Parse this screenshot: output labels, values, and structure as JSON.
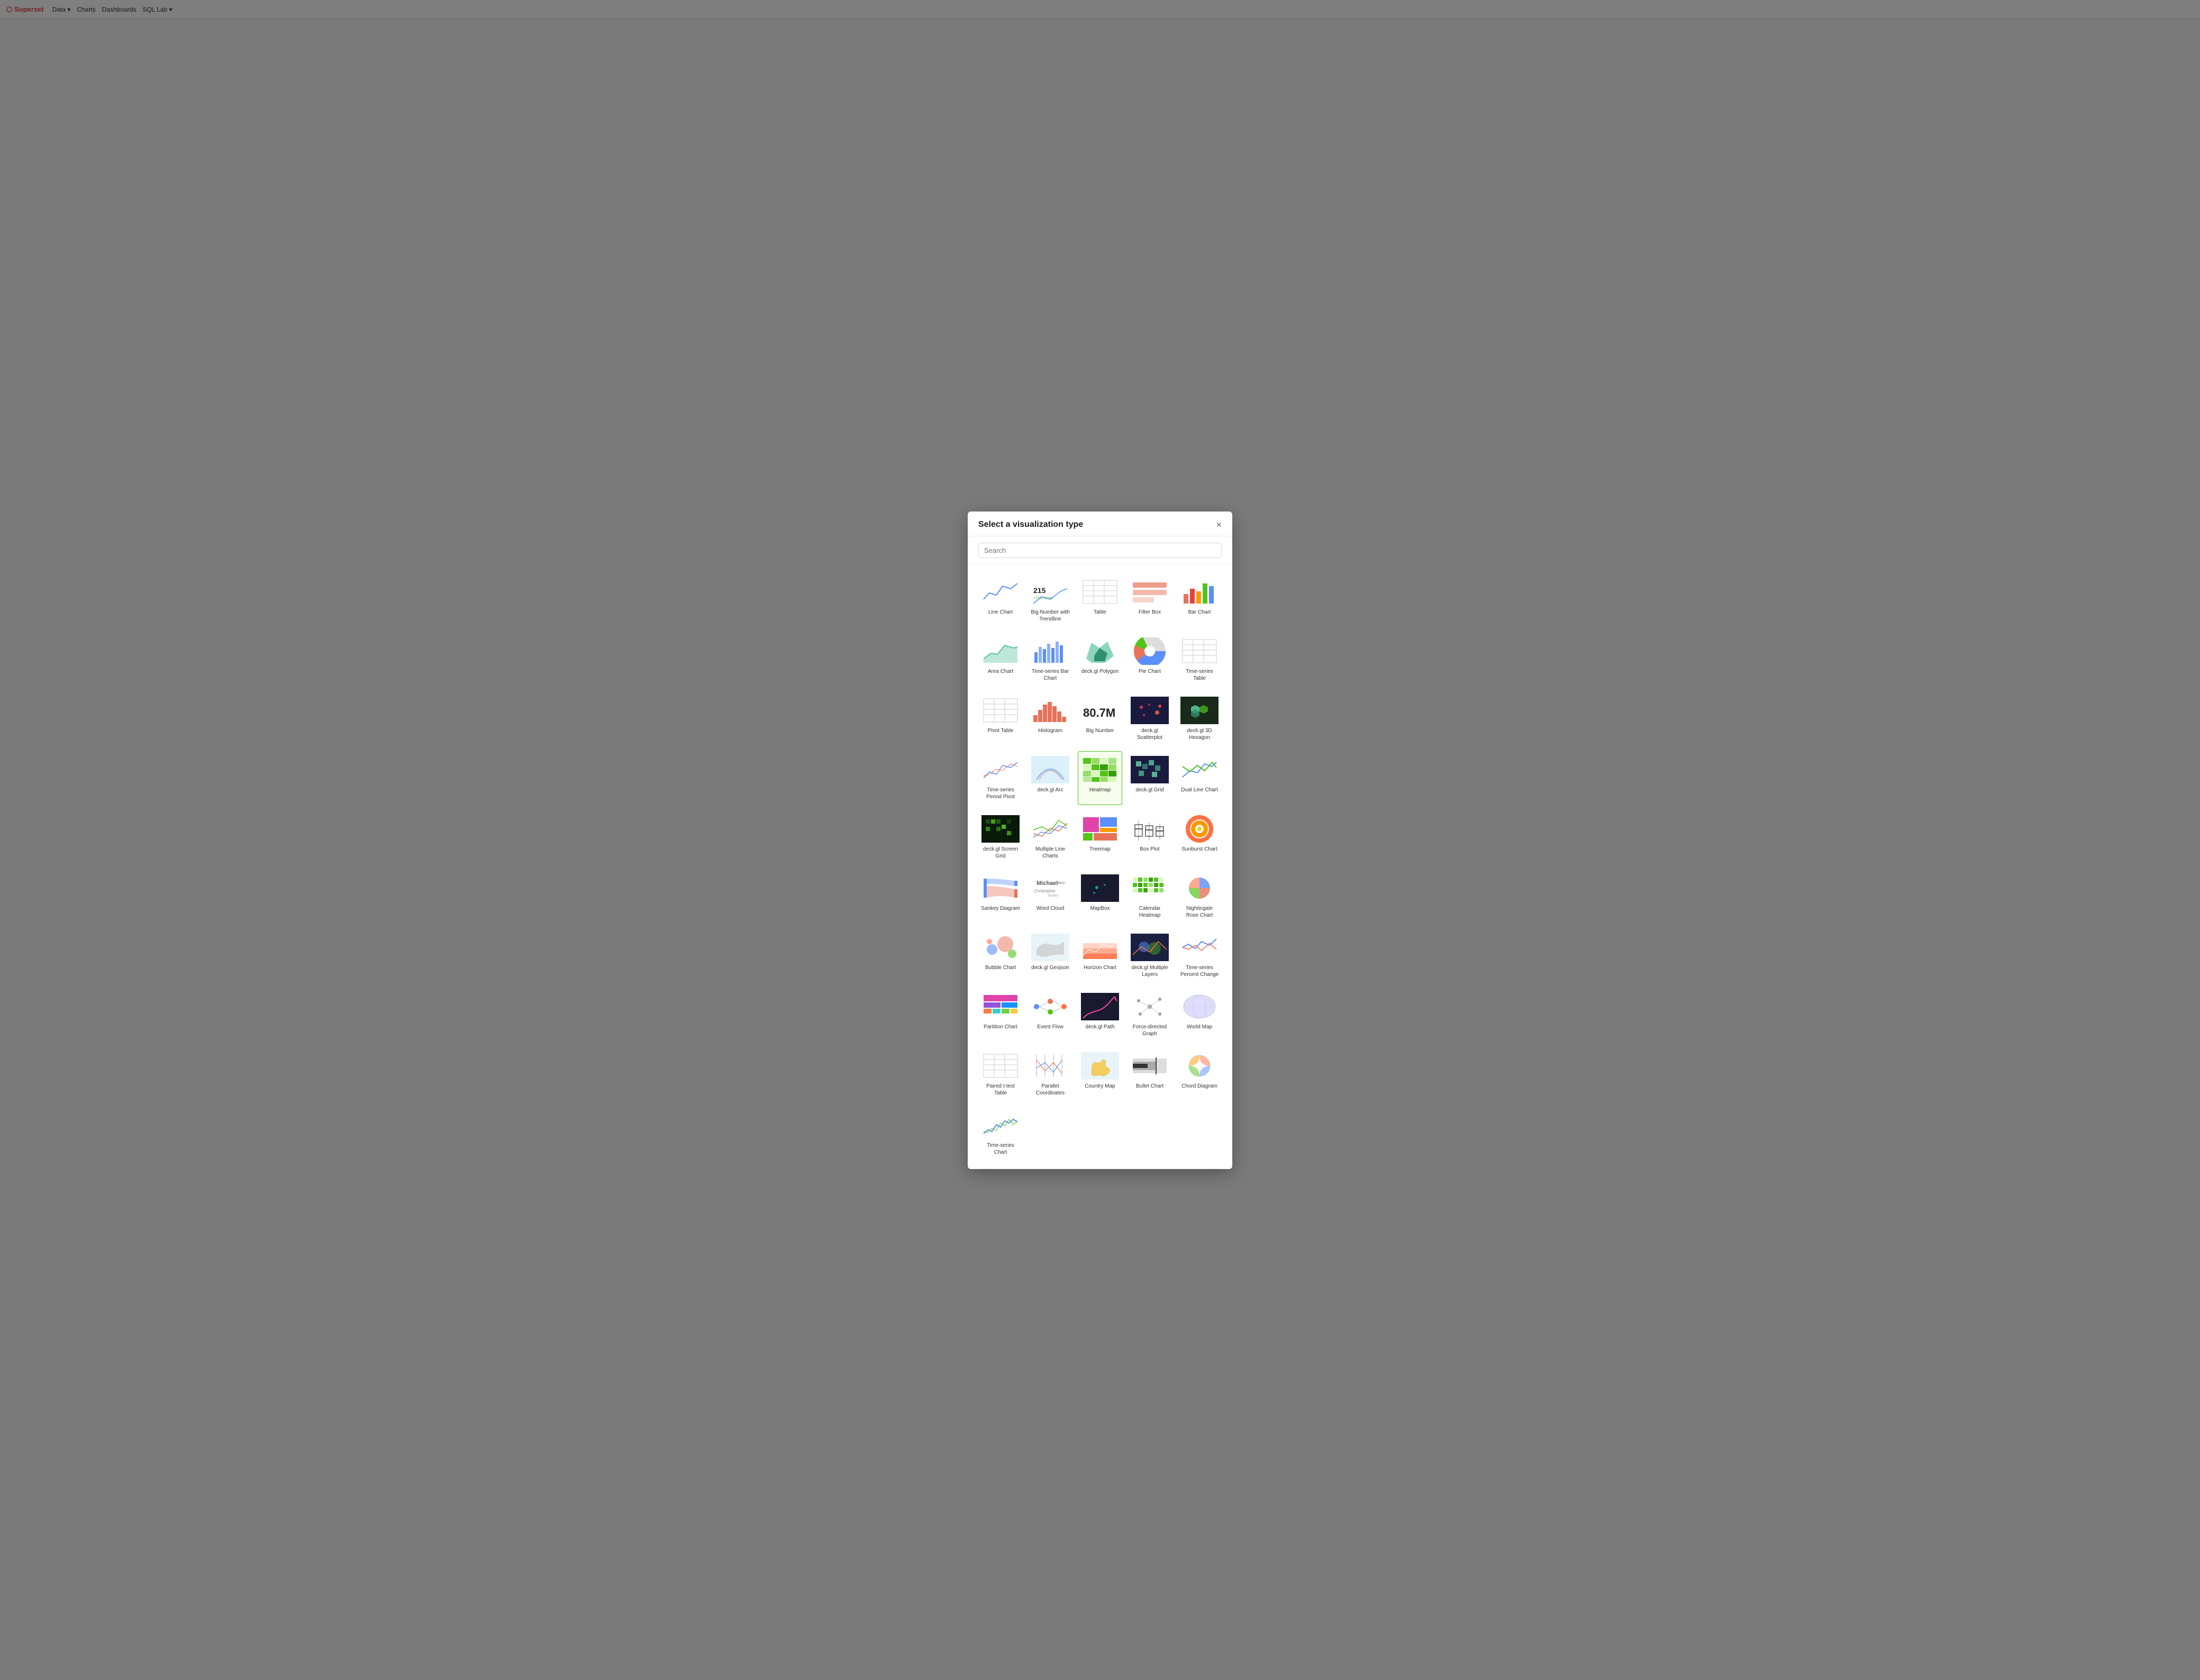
{
  "modal": {
    "title": "Select a visualization type",
    "search_placeholder": "Search",
    "close_label": "×"
  },
  "viz_types": [
    {
      "id": "line-chart",
      "label": "Line Chart",
      "color": "#5b8ff9",
      "type": "line"
    },
    {
      "id": "big-number-trendline",
      "label": "Big Number with Trendline",
      "color": "#5b8ff9",
      "type": "big-number-trend"
    },
    {
      "id": "table",
      "label": "Table",
      "color": "#aaa",
      "type": "table"
    },
    {
      "id": "filter-box",
      "label": "Filter Box",
      "color": "#e8735a",
      "type": "filter-box"
    },
    {
      "id": "bar-chart",
      "label": "Bar Chart",
      "color": "#e8735a",
      "type": "bar"
    },
    {
      "id": "area-chart",
      "label": "Area Chart",
      "color": "#5bc49f",
      "type": "area"
    },
    {
      "id": "time-series-bar",
      "label": "Time-series Bar Chart",
      "color": "#5b8ff9",
      "type": "ts-bar"
    },
    {
      "id": "deckgl-polygon",
      "label": "deck.gl Polygon",
      "color": "#5bc49f",
      "type": "map-green"
    },
    {
      "id": "pie-chart",
      "label": "Pie Chart",
      "color": "#5b8ff9",
      "type": "pie"
    },
    {
      "id": "time-series-table",
      "label": "Time-series Table",
      "color": "#aaa",
      "type": "table"
    },
    {
      "id": "pivot-table",
      "label": "Pivot Table",
      "color": "#aaa",
      "type": "table"
    },
    {
      "id": "histogram",
      "label": "Histogram",
      "color": "#e8735a",
      "type": "histogram"
    },
    {
      "id": "big-number",
      "label": "Big Number",
      "color": "#000",
      "type": "big-number"
    },
    {
      "id": "deckgl-scatter",
      "label": "deck.gl Scatterplot",
      "color": "#e8735a",
      "type": "scatter-map"
    },
    {
      "id": "deckgl-3d-hexagon",
      "label": "deck.gl 3D Hexagon",
      "color": "#5bc49f",
      "type": "hex3d"
    },
    {
      "id": "time-series-period-pivot",
      "label": "Time-series Period Pivot",
      "color": "#aaa",
      "type": "line2"
    },
    {
      "id": "deckgl-arc",
      "label": "deck.gl Arc",
      "color": "#87ceeb",
      "type": "arc"
    },
    {
      "id": "heatmap",
      "label": "Heatmap",
      "color": "#52c41a",
      "type": "heatmap",
      "selected": true
    },
    {
      "id": "deckgl-grid",
      "label": "deck.gl Grid",
      "color": "#5bc49f",
      "type": "grid-map"
    },
    {
      "id": "dual-line-chart",
      "label": "Dual Line Chart",
      "color": "#5b8ff9",
      "type": "dual-line"
    },
    {
      "id": "deckgl-screen-grid",
      "label": "deck.gl Screen Grid",
      "color": "#2d5016",
      "type": "screen-grid"
    },
    {
      "id": "multiple-line-charts",
      "label": "Multiple Line Charts",
      "color": "#e8735a",
      "type": "multi-line"
    },
    {
      "id": "treemap",
      "label": "Treemap",
      "color": "#e044ab",
      "type": "treemap"
    },
    {
      "id": "box-plot",
      "label": "Box Plot",
      "color": "#aaa",
      "type": "box-plot"
    },
    {
      "id": "sunburst",
      "label": "Sunburst Chart",
      "color": "#ff7043",
      "type": "sunburst"
    },
    {
      "id": "sankey",
      "label": "Sankey Diagram",
      "color": "#5b8ff9",
      "type": "sankey"
    },
    {
      "id": "word-cloud",
      "label": "Word Cloud",
      "color": "#333",
      "type": "word-cloud"
    },
    {
      "id": "mapbox",
      "label": "MapBox",
      "color": "#1a1a2e",
      "type": "dark-map"
    },
    {
      "id": "calendar-heatmap",
      "label": "Calendar Heatmap",
      "color": "#5bc49f",
      "type": "calendar"
    },
    {
      "id": "nightingale",
      "label": "Nightingale Rose Chart",
      "color": "#5b8ff9",
      "type": "nightingale"
    },
    {
      "id": "bubble",
      "label": "Bubble Chart",
      "color": "#5b8ff9",
      "type": "bubble"
    },
    {
      "id": "deckgl-geojson",
      "label": "deck.gl Geojson",
      "color": "#ccc",
      "type": "geo"
    },
    {
      "id": "horizon",
      "label": "Horizon Chart",
      "color": "#ff7043",
      "type": "horizon"
    },
    {
      "id": "deckgl-multiple-layers",
      "label": "deck.gl Multiple Layers",
      "color": "#5b8ff9",
      "type": "multi-layer"
    },
    {
      "id": "time-series-percent",
      "label": "Time-series Percent Change",
      "color": "#aaa",
      "type": "ts-percent"
    },
    {
      "id": "partition-chart",
      "label": "Partition Chart",
      "color": "#e044ab",
      "type": "partition"
    },
    {
      "id": "event-flow",
      "label": "Event Flow",
      "color": "#5b8ff9",
      "type": "event-flow"
    },
    {
      "id": "deckgl-path",
      "label": "deck.gl Path",
      "color": "#1a1a2e",
      "type": "dark-path"
    },
    {
      "id": "force-directed",
      "label": "Force-directed Graph",
      "color": "#aaa",
      "type": "force"
    },
    {
      "id": "world-map",
      "label": "World Map",
      "color": "#ccc",
      "type": "world"
    },
    {
      "id": "paired-ttest",
      "label": "Paired t-test Table",
      "color": "#aaa",
      "type": "table"
    },
    {
      "id": "parallel-coords",
      "label": "Parallel Coordinates",
      "color": "#e8735a",
      "type": "parallel"
    },
    {
      "id": "country-map",
      "label": "Country Map",
      "color": "#f6c94e",
      "type": "country"
    },
    {
      "id": "bullet",
      "label": "Bullet Chart",
      "color": "#333",
      "type": "bullet"
    },
    {
      "id": "chord",
      "label": "Chord Diagram",
      "color": "#ff7043",
      "type": "chord"
    },
    {
      "id": "time-series-chart",
      "label": "Time-series Chart",
      "color": "#5b8ff9",
      "type": "ts-chart"
    }
  ]
}
